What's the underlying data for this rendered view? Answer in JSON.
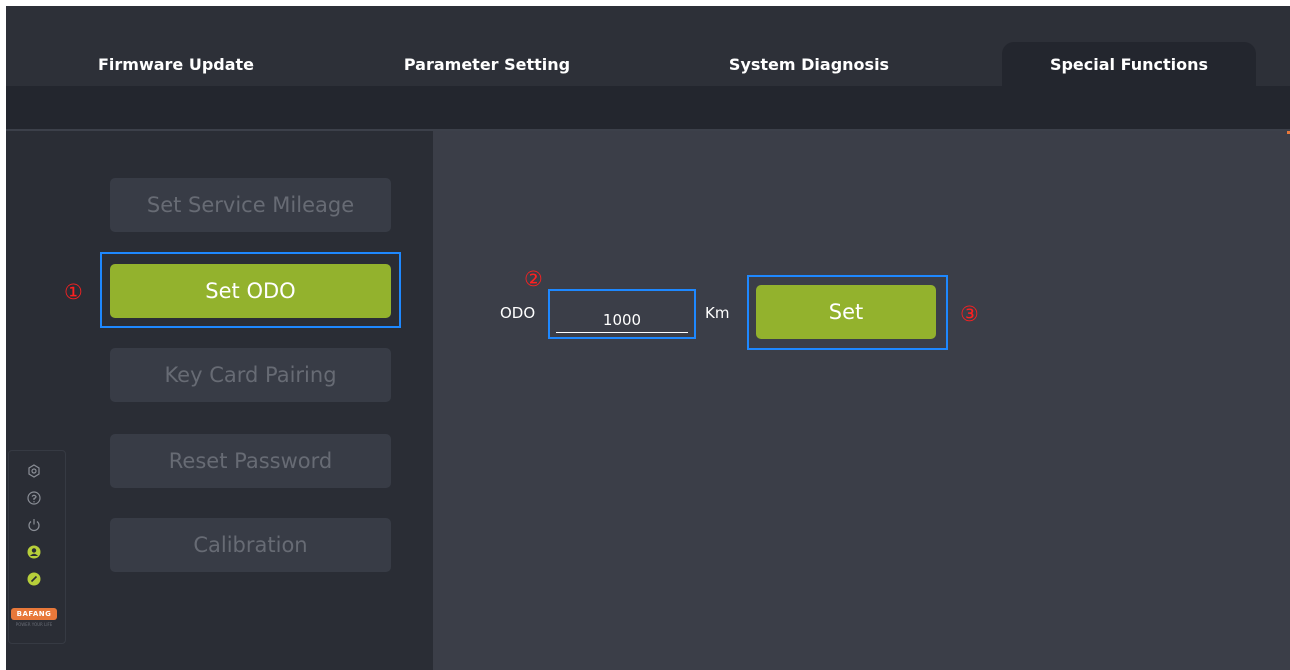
{
  "tabs": [
    {
      "label": "Firmware Update",
      "active": false
    },
    {
      "label": "Parameter Setting",
      "active": false
    },
    {
      "label": "System Diagnosis",
      "active": false
    },
    {
      "label": "Special Functions",
      "active": true
    }
  ],
  "sidebar": {
    "items": [
      {
        "label": "Set Service Mileage",
        "active": false
      },
      {
        "label": "Set ODO",
        "active": true
      },
      {
        "label": "Key Card Pairing",
        "active": false
      },
      {
        "label": "Reset Password",
        "active": false
      },
      {
        "label": "Calibration",
        "active": false
      }
    ],
    "icons": [
      "settings-icon",
      "help-icon",
      "power-icon",
      "user-icon",
      "link-icon"
    ],
    "logo": "BAFANG",
    "logo_tagline": "POWER YOUR LIFE"
  },
  "odo_form": {
    "label": "ODO",
    "value": "1000",
    "unit": "Km",
    "set_label": "Set"
  },
  "annotations": {
    "step1": "①",
    "step2": "②",
    "step3": "③"
  },
  "colors": {
    "accent_green": "#93b22d",
    "highlight_blue": "#1e88ff",
    "annotation_red": "#ff2020",
    "brand_orange": "#e8783a"
  }
}
